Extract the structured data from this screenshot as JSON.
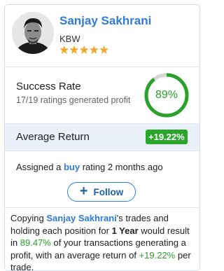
{
  "analyst": {
    "name": "Sanjay Sakhrani",
    "firm": "KBW",
    "stars": "★★★★★",
    "star_rating": 5
  },
  "success_rate": {
    "title": "Success Rate",
    "subtitle": "17/19 ratings generated profit",
    "percent_text": "89%",
    "fraction": 0.8947
  },
  "average_return": {
    "label": "Average Return",
    "value": "+19.22%"
  },
  "assigned": {
    "prefix": "Assigned a",
    "rating": "buy",
    "suffix": "rating 2 months ago"
  },
  "follow_button": {
    "icon": "+",
    "label": "Follow"
  },
  "description": {
    "p1": "Copying",
    "name": "Sanjay Sakhrani",
    "p2": "'s trades and holding each position for",
    "period": "1 Year",
    "p3": "would result in",
    "success_pct": "89.47%",
    "p4": "of your transactions generating a profit, with an average return of",
    "avg_return": "+19.22%",
    "p5": "per trade."
  },
  "colors": {
    "name_blue": "#2f7bd6",
    "success_green": "#2aa12a",
    "badge_green": "#2ba52b",
    "star_orange": "#f5a623",
    "avg_row_bg": "#eaf0fa",
    "ring_track": "#d6d6d6"
  }
}
